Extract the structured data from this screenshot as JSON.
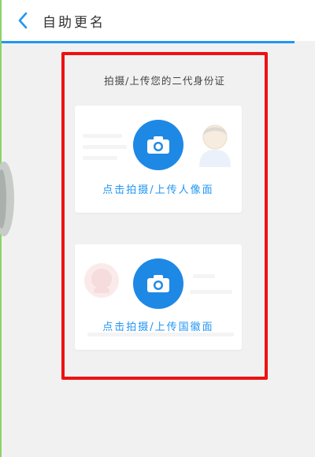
{
  "header": {
    "title": "自助更名",
    "back_icon": "chevron-left-icon",
    "accent_color": "#2196f3"
  },
  "main": {
    "instruction": "拍摄/上传您的二代身份证",
    "cards": [
      {
        "caption": "点击拍摄/上传人像面",
        "icon": "camera-icon",
        "watermark": "portrait-silhouette-icon"
      },
      {
        "caption": "点击拍摄/上传国徽面",
        "icon": "camera-icon",
        "watermark": "national-emblem-icon"
      }
    ],
    "button_color": "#1e88e5",
    "highlight_color": "#ee1111"
  }
}
